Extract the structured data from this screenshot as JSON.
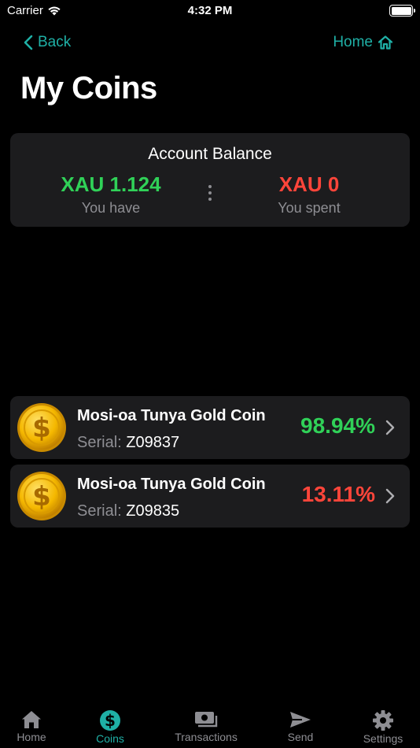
{
  "status_bar": {
    "carrier": "Carrier",
    "time": "4:32 PM"
  },
  "nav": {
    "back_label": "Back",
    "home_label": "Home"
  },
  "page_title": "My Coins",
  "balance": {
    "title": "Account Balance",
    "have_value": "XAU 1.124",
    "have_caption": "You have",
    "spent_value": "XAU 0",
    "spent_caption": "You spent",
    "have_color": "#30d158",
    "spent_color": "#ff453a"
  },
  "coins": [
    {
      "name": "Mosi-oa Tunya Gold Coin",
      "serial_label": "Serial:",
      "serial": "Z09837",
      "percent": "98.94%",
      "percent_color": "#30d158",
      "icon": "gold-dollar-coin"
    },
    {
      "name": "Mosi-oa Tunya Gold Coin",
      "serial_label": "Serial:",
      "serial": "Z09835",
      "percent": "13.11%",
      "percent_color": "#ff453a",
      "icon": "gold-dollar-coin"
    }
  ],
  "tabs": [
    {
      "label": "Home",
      "icon": "house-icon",
      "active": false
    },
    {
      "label": "Coins",
      "icon": "dollar-circle-icon",
      "active": true
    },
    {
      "label": "Transactions",
      "icon": "cash-stack-icon",
      "active": false
    },
    {
      "label": "Send",
      "icon": "paper-plane-icon",
      "active": false
    },
    {
      "label": "Settings",
      "icon": "gear-icon",
      "active": false
    }
  ],
  "colors": {
    "accent": "#1fb0a6",
    "card_bg": "#1c1c1e",
    "muted": "#8e8e93"
  }
}
